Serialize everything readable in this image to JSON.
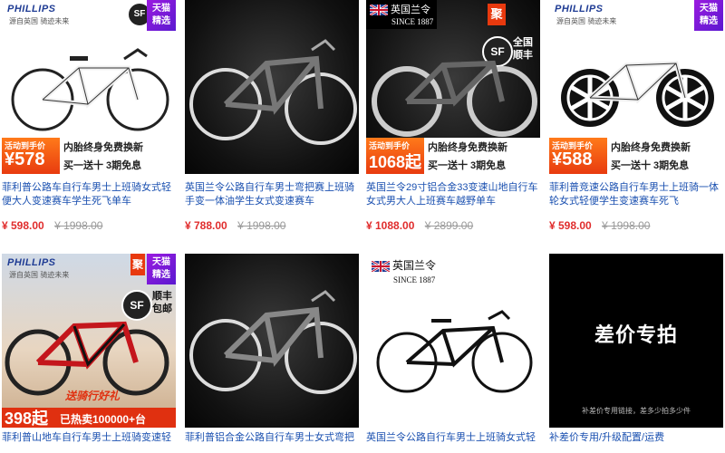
{
  "products": [
    {
      "title": "菲利普公路车自行车男士上班骑女式轻便大人变速赛车学生死飞单车",
      "price": "¥ 598.00",
      "orig": "¥ 1998.00",
      "brand": "PHILLIPS",
      "brand_sub": "源自英国 骑迹未来",
      "corner": [
        "天猫",
        "精选"
      ],
      "promo_label": "活动到手价",
      "promo_price": "¥578起",
      "promo_line1": "内胎终身免费换新",
      "promo_line2": "买一送十  3期免息",
      "sf": "SF"
    },
    {
      "title": "英国兰令公路自行车男士弯把赛上班骑手变一体油学生女式变速赛车",
      "price": "¥ 788.00",
      "orig": "¥ 1998.00"
    },
    {
      "title": "英国兰令29寸铝合金33变速山地自行车女式男大人上班赛车越野单车",
      "price": "¥ 1088.00",
      "orig": "¥ 2899.00",
      "brand": "英国兰令",
      "brand_sub": "SINCE 1887",
      "badge_ju": "聚",
      "sf_text": "全国顺丰",
      "sf": "SF",
      "promo_label": "活动到手价",
      "promo_price": "1068起",
      "promo_line1": "内胎终身免费换新",
      "promo_line2": "买一送十  3期免息"
    },
    {
      "title": "菲利普竞速公路自行车男士上班骑一体轮女式轻便学生变速赛车死飞",
      "price": "¥ 598.00",
      "orig": "¥ 1998.00",
      "brand": "PHILLIPS",
      "brand_sub": "源自英国 骑迹未来",
      "corner": [
        "天猫",
        "精选"
      ],
      "promo_label": "活动到手价",
      "promo_price": "¥588起",
      "promo_line1": "内胎终身免费换新",
      "promo_line2": "买一送十  3期免息"
    },
    {
      "title": "菲利普山地车自行车男士上班骑变速轻便",
      "brand": "PHILLIPS",
      "brand_sub": "源自英国 骑迹未来",
      "badge_ju": "聚",
      "corner": [
        "天猫",
        "精选"
      ],
      "sf": "SF",
      "sf_text": "顺丰包邮",
      "bottom_price": "398起",
      "bottom_text": "已热卖100000+台",
      "gift_text": "送骑行好礼"
    },
    {
      "title": "菲利普铝合金公路自行车男士女式弯把变速"
    },
    {
      "title": "英国兰令公路自行车男士上班骑女式轻便",
      "brand": "英国兰令",
      "brand_sub": "SINCE 1887"
    },
    {
      "title": "补差价专用/升级配置/运费",
      "big_text": "差价专拍",
      "note": "补差价专用链接，差多少拍多少件"
    }
  ],
  "colors": {
    "link": "#1a50b0",
    "price": "#e02d2d",
    "promo_orange": "#e83b0f",
    "tmall_purple": "#7a1ae0"
  }
}
